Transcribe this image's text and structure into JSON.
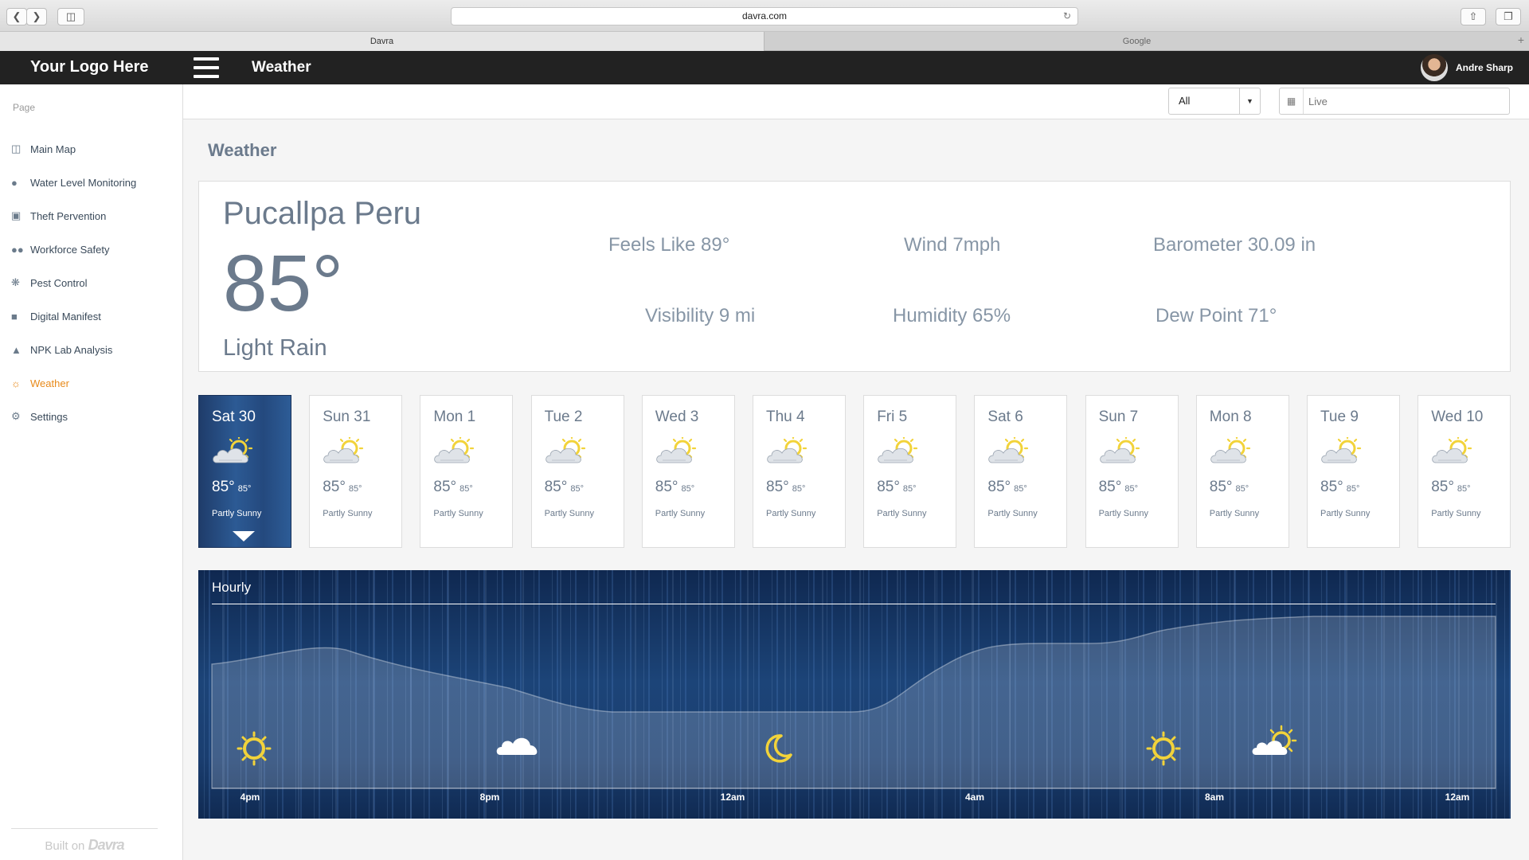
{
  "browser": {
    "url": "davra.com",
    "tabs": [
      {
        "label": "Davra"
      },
      {
        "label": "Google"
      }
    ]
  },
  "header": {
    "logo": "Your Logo Here",
    "title": "Weather",
    "user_name": "Andre Sharp"
  },
  "sidebar": {
    "heading": "Page",
    "items": [
      {
        "label": "Main Map",
        "icon": "map-icon"
      },
      {
        "label": "Water Level Monitoring",
        "icon": "drop-icon"
      },
      {
        "label": "Theft Pervention",
        "icon": "lock-icon"
      },
      {
        "label": "Workforce Safety",
        "icon": "users-icon"
      },
      {
        "label": "Pest Control",
        "icon": "bug-icon"
      },
      {
        "label": "Digital Manifest",
        "icon": "truck-icon"
      },
      {
        "label": "NPK Lab Analysis",
        "icon": "flask-icon"
      },
      {
        "label": "Weather",
        "icon": "sun-icon",
        "active": true
      },
      {
        "label": "Settings",
        "icon": "gear-icon"
      }
    ],
    "footer_prefix": "Built on",
    "footer_brand": "Davra"
  },
  "filters": {
    "select_value": "All",
    "date_placeholder": "Live"
  },
  "page_title": "Weather",
  "current": {
    "city": "Pucallpa Peru",
    "temp": "85°",
    "condition": "Light Rain",
    "feels_like": "Feels Like  89°",
    "wind": "Wind  7mph",
    "barometer": "Barometer 30.09 in",
    "visibility": "Visibility  9 mi",
    "humidity": "Humidity 65%",
    "dew_point": "Dew Point 71°"
  },
  "forecast": [
    {
      "day": "Sat 30",
      "high": "85°",
      "low": "85°",
      "desc": "Partly Sunny",
      "selected": true
    },
    {
      "day": "Sun 31",
      "high": "85°",
      "low": "85°",
      "desc": "Partly Sunny"
    },
    {
      "day": "Mon 1",
      "high": "85°",
      "low": "85°",
      "desc": "Partly Sunny"
    },
    {
      "day": "Tue 2",
      "high": "85°",
      "low": "85°",
      "desc": "Partly Sunny"
    },
    {
      "day": "Wed 3",
      "high": "85°",
      "low": "85°",
      "desc": "Partly Sunny"
    },
    {
      "day": "Thu 4",
      "high": "85°",
      "low": "85°",
      "desc": "Partly Sunny"
    },
    {
      "day": "Fri 5",
      "high": "85°",
      "low": "85°",
      "desc": "Partly Sunny"
    },
    {
      "day": "Sat 6",
      "high": "85°",
      "low": "85°",
      "desc": "Partly Sunny"
    },
    {
      "day": "Sun 7",
      "high": "85°",
      "low": "85°",
      "desc": "Partly Sunny"
    },
    {
      "day": "Mon 8",
      "high": "85°",
      "low": "85°",
      "desc": "Partly Sunny"
    },
    {
      "day": "Tue 9",
      "high": "85°",
      "low": "85°",
      "desc": "Partly Sunny"
    },
    {
      "day": "Wed 10",
      "high": "85°",
      "low": "85°",
      "desc": "Partly Sunny"
    }
  ],
  "hourly": {
    "title": "Hourly",
    "labels": [
      "4pm",
      "8pm",
      "12am",
      "4am",
      "8am",
      "12am"
    ],
    "icons": [
      "sun-icon",
      "cloud-icon",
      "moon-icon",
      "sun-icon",
      "partly-sunny-icon"
    ]
  },
  "colors": {
    "accent": "#e88a1a",
    "header_bg": "#222222",
    "text_slate": "#6b7a8c",
    "sun_yellow": "#f2d33a"
  }
}
